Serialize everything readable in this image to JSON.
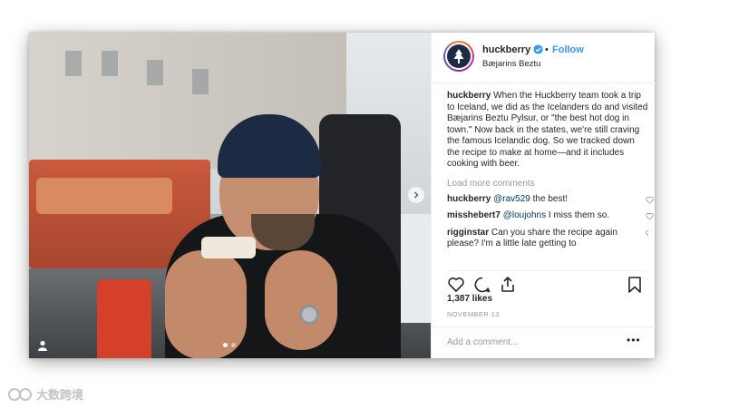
{
  "post": {
    "username": "huckberry",
    "follow_label": "Follow",
    "separator": "•",
    "location": "Bæjarins Beztu",
    "caption_user": "huckberry",
    "caption_text": "When the Huckberry team took a trip to Iceland, we did as the Icelanders do and visited Bæjarins Beztu Pylsur, or \"the best hot dog in town.\" Now back in the states, we're still craving the famous Icelandic dog. So we tracked down the recipe to make at home—and it includes cooking with beer.",
    "load_more": "Load more comments",
    "comments": [
      {
        "user": "huckberry",
        "mention": "@rav529",
        "text": " the best!"
      },
      {
        "user": "misshebert7",
        "mention": "@loujohns",
        "text": " I miss them so."
      },
      {
        "user": "rigginstar",
        "mention": "",
        "text": "Can you share the recipe again please? I'm a little late getting to"
      }
    ],
    "likes": "1,387 likes",
    "date": "NOVEMBER 13",
    "add_comment_placeholder": "Add a comment...",
    "more_options": "•••",
    "carousel": {
      "count": 2,
      "active": 0
    }
  },
  "watermark": {
    "text": "大数跨境"
  },
  "icons": [
    "verified-icon",
    "user-tag-icon",
    "chevron-right-icon",
    "heart-icon",
    "comment-icon",
    "share-icon",
    "bookmark-icon",
    "small-heart-icon",
    "tree-logo-icon"
  ],
  "colors": {
    "link": "#3897f0",
    "mention": "#003569",
    "muted": "#999999",
    "text": "#262626"
  }
}
